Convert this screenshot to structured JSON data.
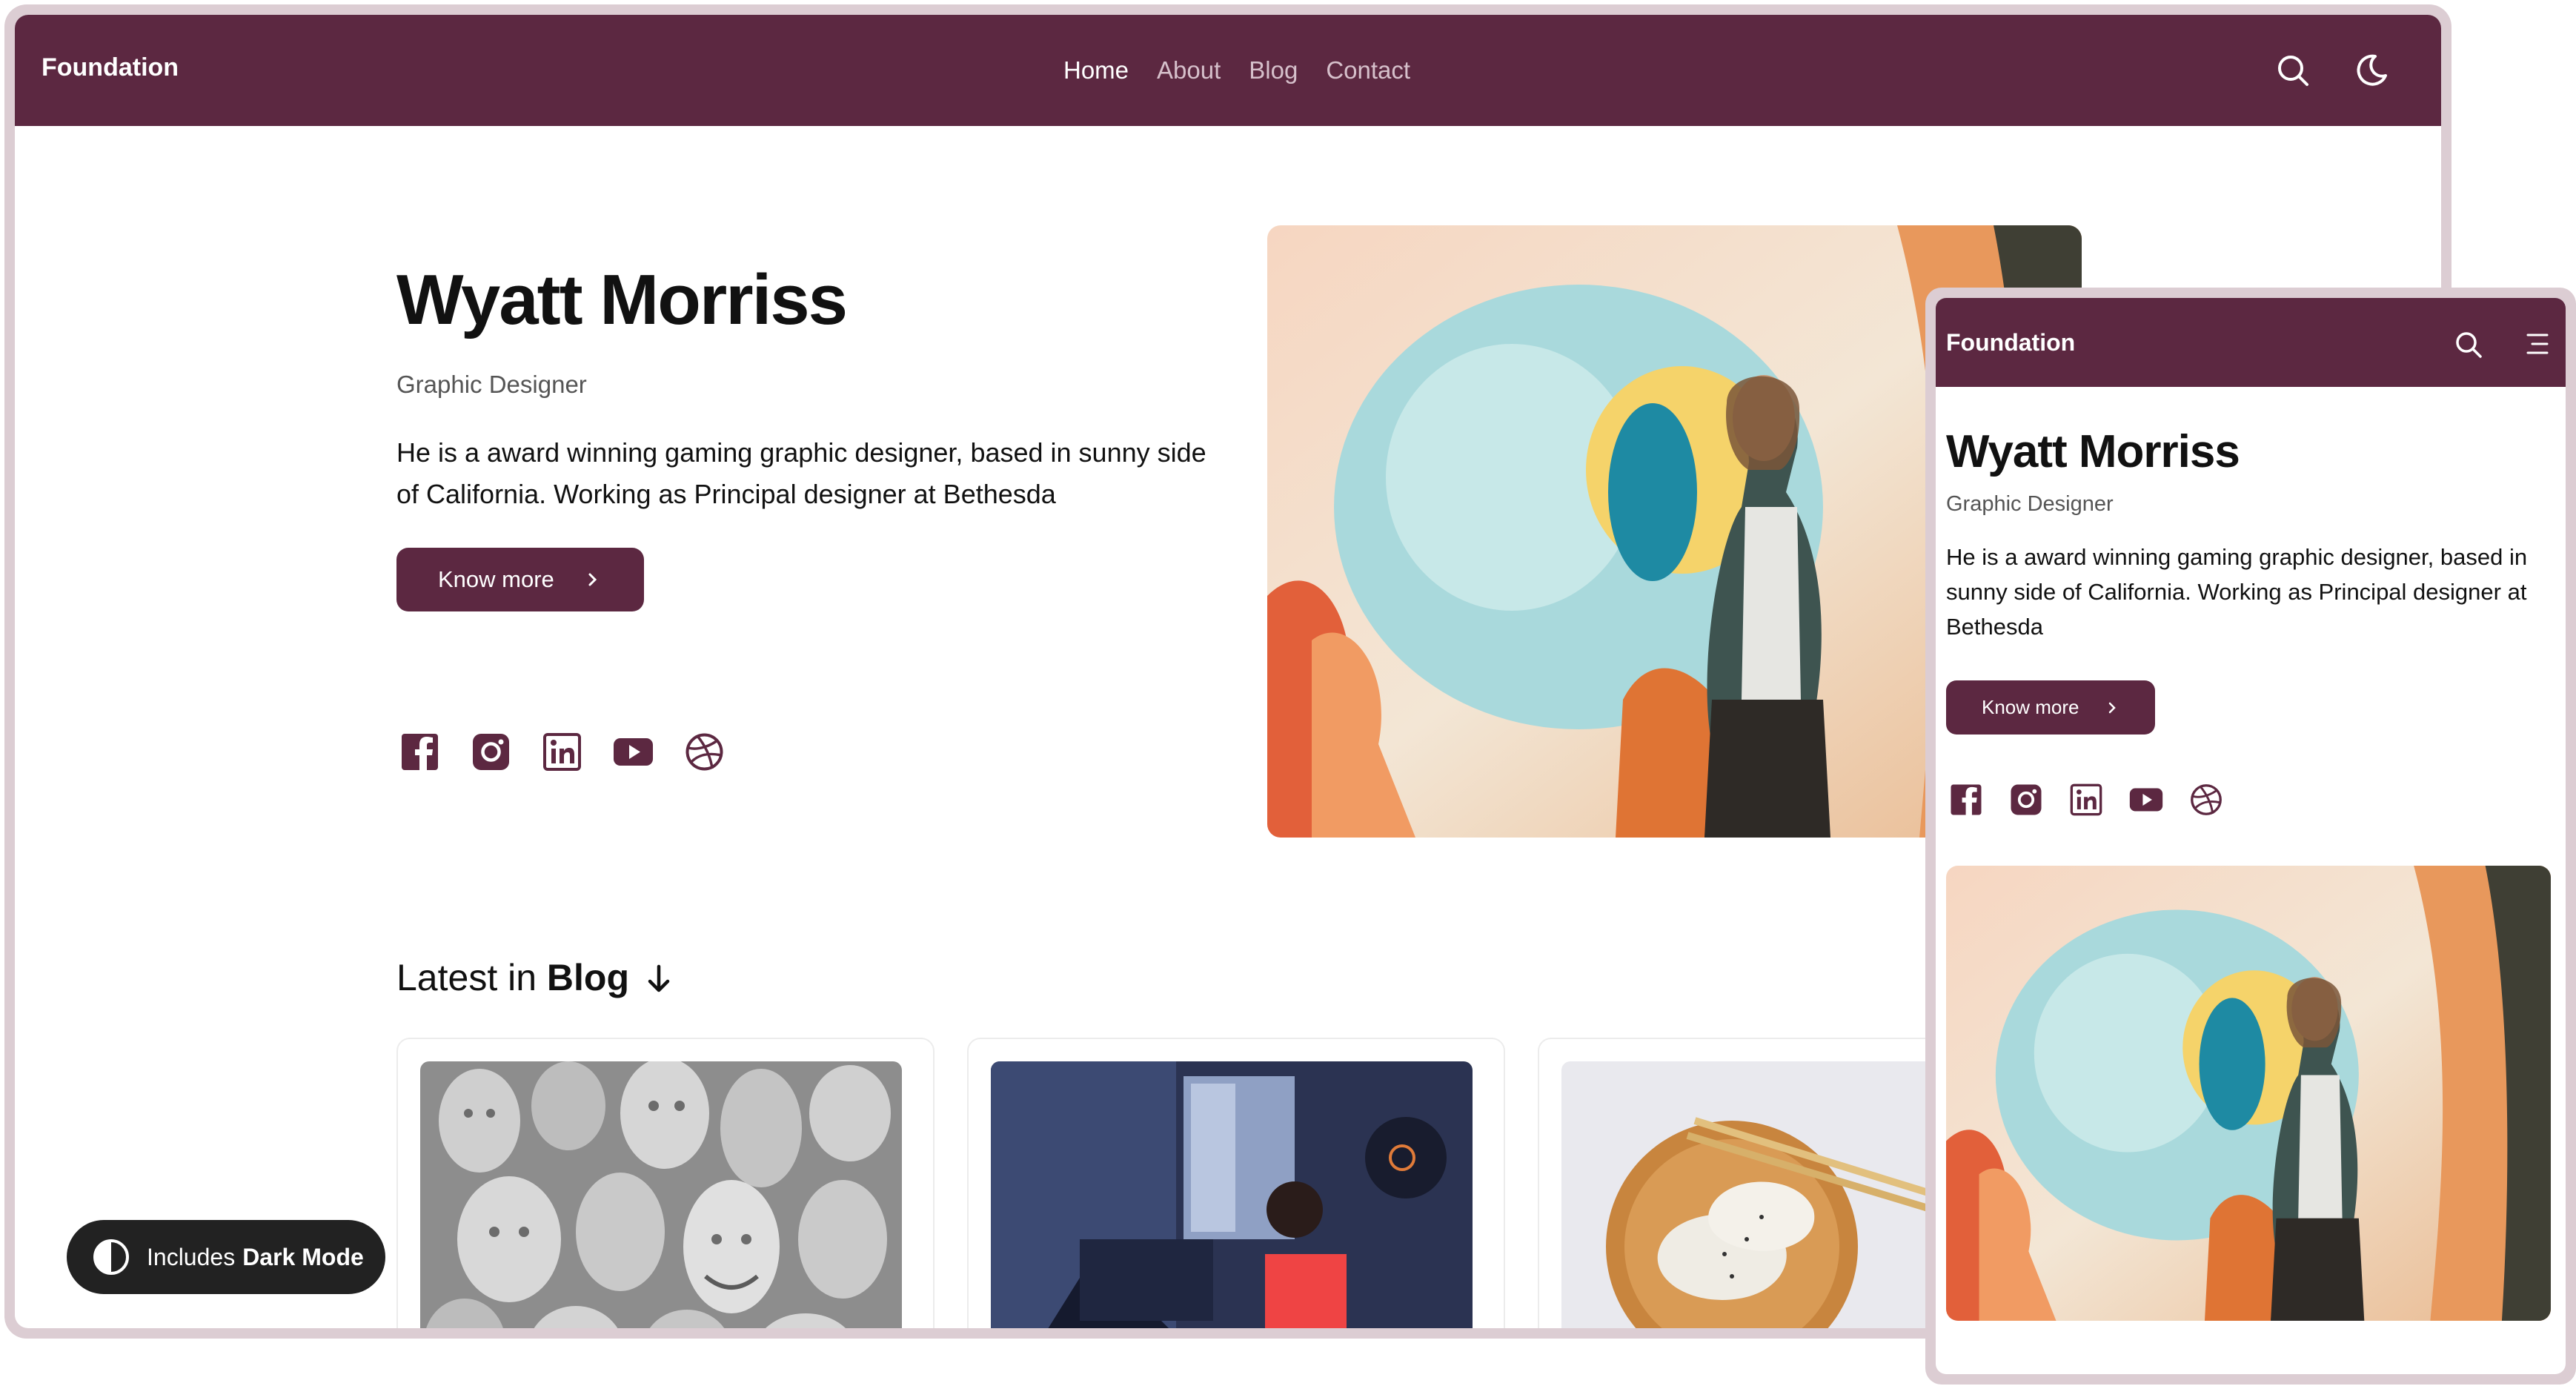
{
  "brand": "Foundation",
  "nav": {
    "links": [
      "Home",
      "About",
      "Blog",
      "Contact"
    ],
    "active": "Home"
  },
  "hero": {
    "name": "Wyatt Morriss",
    "role": "Graphic Designer",
    "bio": "He is a award winning gaming graphic designer, based in sunny side of California. Working as Principal designer at Bethesda",
    "cta": "Know more"
  },
  "social_icons": [
    "facebook-icon",
    "instagram-icon",
    "linkedin-icon",
    "youtube-icon",
    "dribbble-icon"
  ],
  "blog": {
    "heading_prefix": "Latest in",
    "heading_bold": "Blog"
  },
  "badge": {
    "prefix": "Includes",
    "bold": "Dark Mode"
  },
  "colors": {
    "brand": "#5c2841",
    "frame": "#dccdd3"
  }
}
